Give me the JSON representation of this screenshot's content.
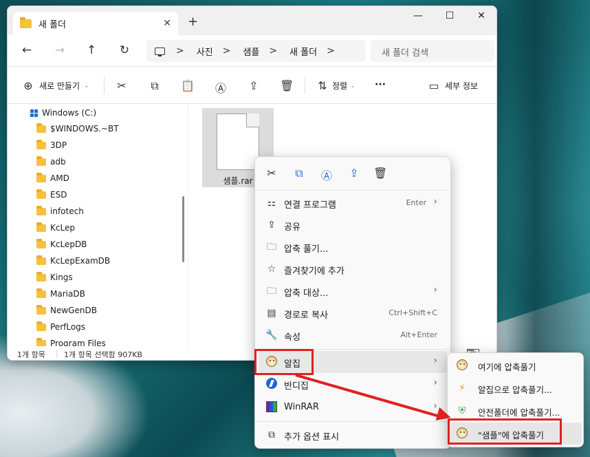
{
  "window": {
    "tab_title": "새 폴더",
    "tab_close": "✕",
    "new_tab": "+",
    "controls": {
      "minimize": "—",
      "maximize": "☐",
      "close": "✕"
    }
  },
  "nav": {
    "back": "←",
    "forward": "→",
    "up": "↑",
    "refresh": "↻"
  },
  "address": {
    "crumbs": [
      "사진",
      "샘플",
      "새 폴더"
    ],
    "separator": ">",
    "search_placeholder": "새 폴더 검색"
  },
  "toolbar": {
    "new_label": "새로 만들기",
    "sort_label": "정렬",
    "more_label": "···",
    "details_label": "세부 정보"
  },
  "sidebar": {
    "drive": "Windows (C:)",
    "folders": [
      "$WINDOWS.~BT",
      "3DP",
      "adb",
      "AMD",
      "ESD",
      "infotech",
      "KcLep",
      "KcLepDB",
      "KcLepExamDB",
      "Kings",
      "MariaDB",
      "NewGenDB",
      "PerfLogs",
      "Program Files"
    ]
  },
  "content": {
    "file_name": "샘플.rar"
  },
  "status": {
    "count": "1개 항목",
    "selection": "1개 항목 선택함 907KB"
  },
  "context_menu": {
    "items": [
      {
        "label": "연결 프로그램",
        "shortcut": "Enter",
        "arrow": true,
        "icon": "open-with-icon"
      },
      {
        "label": "공유",
        "shortcut": "",
        "arrow": false,
        "icon": "share-icon"
      },
      {
        "label": "압축 풀기...",
        "shortcut": "",
        "arrow": false,
        "icon": "extract-icon"
      },
      {
        "label": "즐겨찾기에 추가",
        "shortcut": "",
        "arrow": false,
        "icon": "star-icon"
      },
      {
        "label": "압축 대상...",
        "shortcut": "",
        "arrow": true,
        "icon": "compress-icon"
      },
      {
        "label": "경로로 복사",
        "shortcut": "Ctrl+Shift+C",
        "arrow": false,
        "icon": "copy-path-icon"
      },
      {
        "label": "속성",
        "shortcut": "Alt+Enter",
        "arrow": false,
        "icon": "wrench-icon"
      }
    ],
    "apps": [
      {
        "label": "알집",
        "icon": "alzip-icon"
      },
      {
        "label": "반디집",
        "icon": "bandizip-icon"
      },
      {
        "label": "WinRAR",
        "icon": "winrar-icon"
      }
    ],
    "more_options": "추가 옵션 표시"
  },
  "submenu": {
    "items": [
      "여기에 압축풀기",
      "알집으로 압축풀기...",
      "안전폴더에 압축풀기...",
      "\"샘플\"에 압축풀기"
    ]
  },
  "colors": {
    "highlight": "#e02020",
    "accent": "#2a6fd6",
    "folder": "#f5c23d"
  }
}
